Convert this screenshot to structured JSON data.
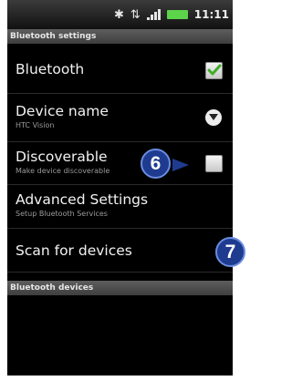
{
  "status_bar": {
    "bluetooth_icon": "bluetooth-icon",
    "network_icon": "network-icon",
    "signal_icon": "signal-icon",
    "battery_icon": "battery-icon",
    "battery_color": "#5bd34a",
    "time": "11:11"
  },
  "settings": {
    "header": "Bluetooth settings",
    "rows": [
      {
        "title": "Bluetooth",
        "subtitle": "",
        "control": "checkbox",
        "checked": true
      },
      {
        "title": "Device name",
        "subtitle": "HTC Vision",
        "control": "dropdown-icon"
      },
      {
        "title": "Discoverable",
        "subtitle": "Make device discoverable",
        "control": "checkbox",
        "checked": false
      },
      {
        "title": "Advanced Settings",
        "subtitle": "Setup Bluetooth Services"
      },
      {
        "title": "Scan for devices",
        "subtitle": ""
      }
    ]
  },
  "devices": {
    "header": "Bluetooth devices"
  },
  "callouts": {
    "badge_6": "6",
    "badge_7": "7",
    "badge_color": "#1f3b8f"
  }
}
